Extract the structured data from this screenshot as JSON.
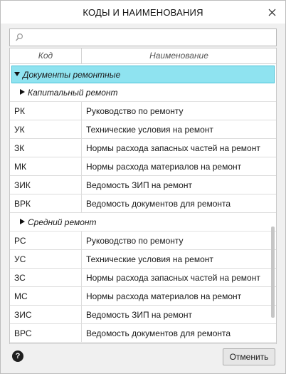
{
  "window": {
    "title": "КОДЫ И НАИМЕНОВАНИЯ",
    "close_icon": "close-icon"
  },
  "search": {
    "value": "",
    "placeholder": "",
    "icon": "search-icon"
  },
  "table": {
    "columns": {
      "code": "Код",
      "name": "Наименование"
    },
    "group": {
      "label": "Документы ремонтные",
      "expanded": true,
      "highlight_color": "#8fe3f0",
      "subgroups": [
        {
          "label": "Капитальный ремонт",
          "rows": [
            {
              "code": "РК",
              "name": "Руководство по ремонту"
            },
            {
              "code": "УК",
              "name": "Технические условия на ремонт"
            },
            {
              "code": "ЗК",
              "name": "Нормы расхода запасных частей на ремонт"
            },
            {
              "code": "МК",
              "name": "Нормы расхода материалов на ремонт"
            },
            {
              "code": "ЗИК",
              "name": "Ведомость ЗИП на ремонт"
            },
            {
              "code": "ВРК",
              "name": "Ведомость документов для ремонта"
            }
          ]
        },
        {
          "label": "Средний ремонт",
          "rows": [
            {
              "code": "РС",
              "name": "Руководство по ремонту"
            },
            {
              "code": "УС",
              "name": "Технические условия на ремонт"
            },
            {
              "code": "ЗС",
              "name": "Нормы расхода запасных частей на ремонт"
            },
            {
              "code": "МС",
              "name": "Нормы расхода материалов на ремонт"
            },
            {
              "code": "ЗИС",
              "name": "Ведомость ЗИП на ремонт"
            },
            {
              "code": "ВРС",
              "name": "Ведомость документов для ремонта"
            }
          ]
        }
      ]
    }
  },
  "footer": {
    "help_label": "?",
    "cancel_label": "Отменить"
  }
}
